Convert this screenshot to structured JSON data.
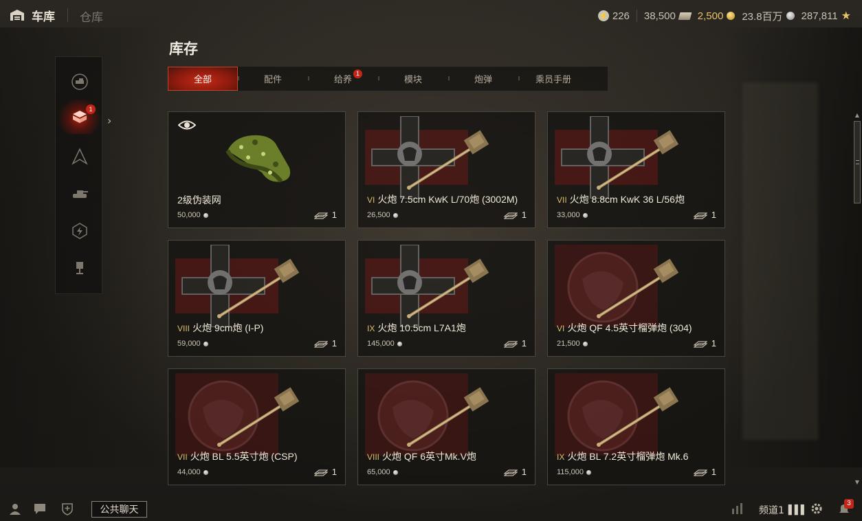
{
  "topbar": {
    "garage_label": "车库",
    "warehouse_label": "仓库",
    "currencies": {
      "free_xp": "226",
      "bonds": "38,500",
      "gold": "2,500",
      "credits_abbrev": "23.8百万",
      "xp": "287,811"
    }
  },
  "page": {
    "title": "库存"
  },
  "sidebar": {
    "items": [
      {
        "name": "sidebar-item-vehicles",
        "icon": "tanks-icon"
      },
      {
        "name": "sidebar-item-inventory",
        "icon": "inventory-icon",
        "badge": "1",
        "active": true
      },
      {
        "name": "sidebar-item-crew",
        "icon": "compass-icon"
      },
      {
        "name": "sidebar-item-tank",
        "icon": "tank-icon"
      },
      {
        "name": "sidebar-item-boosters",
        "icon": "booster-icon"
      },
      {
        "name": "sidebar-item-equipment",
        "icon": "trophy-icon"
      }
    ]
  },
  "tabs": [
    {
      "label": "全部",
      "active": true
    },
    {
      "label": "配件"
    },
    {
      "label": "给养",
      "badge": "1"
    },
    {
      "label": "模块"
    },
    {
      "label": "炮弹"
    },
    {
      "label": "乘员手册"
    }
  ],
  "cards": [
    {
      "tier": "",
      "name": "2级伪装网",
      "price": "50,000",
      "count": "1",
      "type": "camo"
    },
    {
      "tier": "VI",
      "name": "火炮 7.5cm KwK L/70炮 (3002M)",
      "price": "26,500",
      "count": "1",
      "type": "gun",
      "emblem": "cross"
    },
    {
      "tier": "VII",
      "name": "火炮 8.8cm KwK 36 L/56炮",
      "price": "33,000",
      "count": "1",
      "type": "gun",
      "emblem": "cross"
    },
    {
      "tier": "VIII",
      "name": "火炮 9cm炮 (I-P)",
      "price": "59,000",
      "count": "1",
      "type": "gun",
      "emblem": "cross"
    },
    {
      "tier": "IX",
      "name": "火炮 10.5cm L7A1炮",
      "price": "145,000",
      "count": "1",
      "type": "gun",
      "emblem": "cross"
    },
    {
      "tier": "VI",
      "name": "火炮 QF 4.5英寸榴弹炮 (304)",
      "price": "21,500",
      "count": "1",
      "type": "gun",
      "emblem": "lion"
    },
    {
      "tier": "VII",
      "name": "火炮 BL 5.5英寸炮 (CSP)",
      "price": "44,000",
      "count": "1",
      "type": "gun",
      "emblem": "lion"
    },
    {
      "tier": "VIII",
      "name": "火炮 QF 6英寸Mk.V炮",
      "price": "65,000",
      "count": "1",
      "type": "gun",
      "emblem": "lion"
    },
    {
      "tier": "IX",
      "name": "火炮 BL 7.2英寸榴弹炮 Mk.6",
      "price": "115,000",
      "count": "1",
      "type": "gun",
      "emblem": "lion"
    }
  ],
  "bottombar": {
    "chat_label": "公共聊天",
    "channel_label": "频道1",
    "notification_count": "3"
  },
  "colors": {
    "accent_red": "#c42a16",
    "tier_gold": "#e0bf6c",
    "gold_currency": "#e7c36a"
  }
}
